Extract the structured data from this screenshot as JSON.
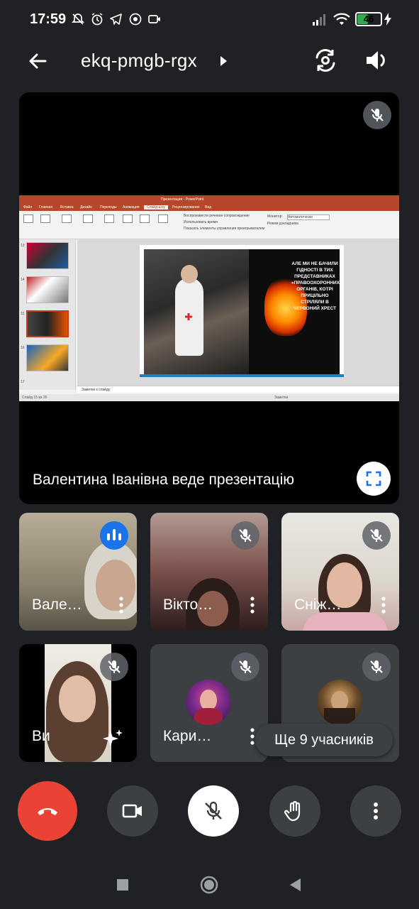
{
  "status_bar": {
    "time": "17:59",
    "battery": "46",
    "battery_level": 0.46,
    "left_icons": [
      "notifications-off-icon",
      "alarm-icon",
      "telegram-icon",
      "viber-icon",
      "screen-record-icon"
    ],
    "right_icons": [
      "signal-icon",
      "wifi-icon",
      "battery-icon",
      "charging-icon"
    ]
  },
  "header": {
    "meeting_code": "ekq-pmgb-rgx",
    "icons": [
      "back-arrow-icon",
      "caret-right-icon",
      "switch-camera-icon",
      "speaker-icon"
    ]
  },
  "presentation": {
    "label": "Валентина Іванівна веде презентацію",
    "slide_text": "АЛЕ МИ НЕ БАЧИЛИ ГІДНОСТІ В ТИХ ПРЕДСТАВНИКАХ «ПРАВООХОРОННИХ» ОРГАНІВ, КОТРІ ПРИЦІЛЬНО СТРІЛЯЛИ В ЧЕРВОНИЙ ХРЕСТ",
    "slide_numbers": [
      "13",
      "14",
      "15",
      "16",
      "17"
    ],
    "notes_placeholder": "Заметки к слайду",
    "status_left": "Слайд 15 из 26",
    "app_title": "Презентация - PowerPoint",
    "tab_labels": [
      "Файл",
      "Главная",
      "Вставка",
      "Дизайн",
      "Переходы",
      "Анимация",
      "Слайд-шоу",
      "Рецензирование",
      "Вид"
    ],
    "checkbox_items": [
      "Воспроизвести речевое сопровождение",
      "Использовать время",
      "Показать элементы управления проигрывателем"
    ],
    "monitor_label": "Монитор:",
    "monitor_value": "Автоматически",
    "presenter_mode": "Режим докладчика",
    "status_right": "Заметки",
    "icons": [
      "mic-off-icon",
      "fullscreen-icon"
    ]
  },
  "participants": [
    {
      "name": "Вале…",
      "state": "speaking",
      "icon": "audio-level-icon"
    },
    {
      "name": "Вікто…",
      "state": "muted",
      "icon": "mic-off-icon"
    },
    {
      "name": "Сніж…",
      "state": "muted",
      "icon": "mic-off-icon"
    },
    {
      "name": "Ви",
      "state": "muted",
      "icon": "mic-off-icon",
      "extra_icon": "visual-effects-icon"
    },
    {
      "name": "Кари…",
      "state": "muted",
      "icon": "mic-off-icon"
    },
    {
      "name": "",
      "state": "muted",
      "icon": "mic-off-icon"
    }
  ],
  "more_participants": "Ще 9 учасників",
  "controls": {
    "icons": [
      "end-call-icon",
      "camera-icon",
      "mic-off-icon",
      "raise-hand-icon",
      "more-options-icon"
    ],
    "end_call_color": "#ea4335"
  },
  "nav_bar": {
    "icons": [
      "recents-square-icon",
      "home-circle-icon",
      "back-triangle-icon"
    ]
  },
  "colors": {
    "background": "#202124",
    "tile": "#3c4043",
    "accent": "#1a73e8"
  }
}
